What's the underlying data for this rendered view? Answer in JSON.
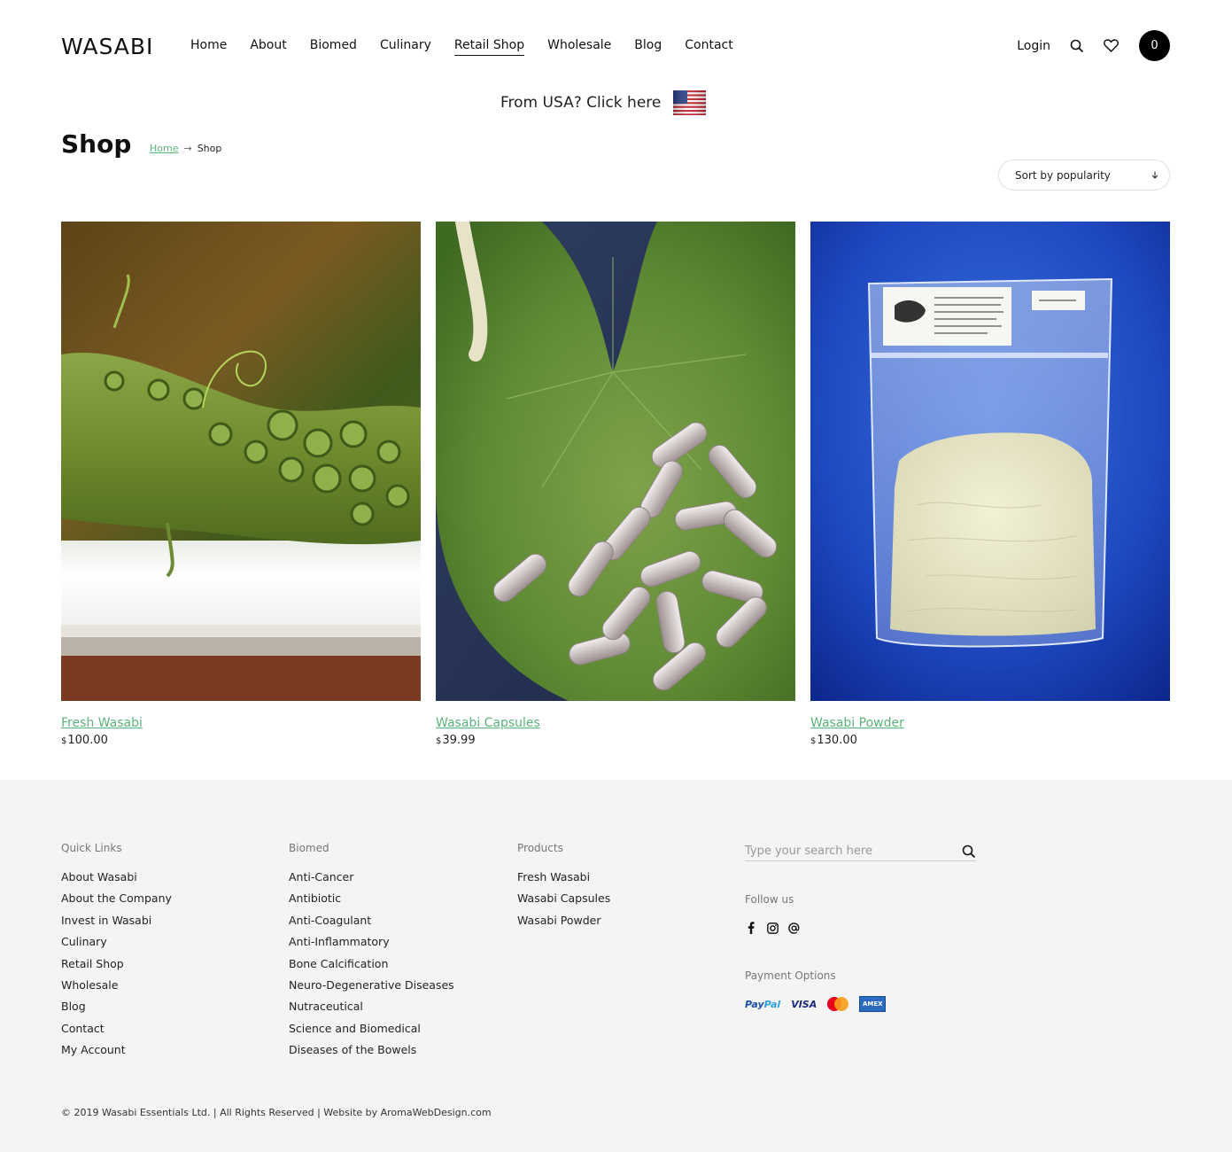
{
  "header": {
    "logo": "WASABI",
    "nav": [
      "Home",
      "About",
      "Biomed",
      "Culinary",
      "Retail Shop",
      "Wholesale",
      "Blog",
      "Contact"
    ],
    "active_nav": "Retail Shop",
    "login": "Login",
    "cart_count": "0",
    "usa_banner": "From USA? Click here"
  },
  "page": {
    "title": "Shop",
    "breadcrumb": {
      "home": "Home",
      "separator": "→",
      "current": "Shop"
    },
    "sort_label": "Sort by popularity"
  },
  "products": [
    {
      "name": "Fresh Wasabi",
      "currency": "$",
      "price": "100.00"
    },
    {
      "name": "Wasabi Capsules",
      "currency": "$",
      "price": "39.99"
    },
    {
      "name": "Wasabi Powder",
      "currency": "$",
      "price": "130.00"
    }
  ],
  "footer": {
    "quick_links": {
      "heading": "Quick Links",
      "items": [
        "About Wasabi",
        "About the Company",
        "Invest in Wasabi",
        "Culinary",
        "Retail Shop",
        "Wholesale",
        "Blog",
        "Contact",
        "My Account"
      ]
    },
    "biomed": {
      "heading": "Biomed",
      "items": [
        "Anti-Cancer",
        "Antibiotic",
        "Anti-Coagulant",
        "Anti-Inflammatory",
        "Bone Calcification",
        "Neuro-Degenerative Diseases",
        "Nutraceutical",
        "Science and Biomedical",
        "Diseases of the Bowels"
      ]
    },
    "products": {
      "heading": "Products",
      "items": [
        "Fresh Wasabi",
        "Wasabi Capsules",
        "Wasabi Powder"
      ]
    },
    "search_placeholder": "Type your search here",
    "follow_label": "Follow us",
    "social_icons": [
      "facebook-icon",
      "instagram-icon",
      "email-icon"
    ],
    "payment_label": "Payment Options",
    "payments": {
      "paypal_a": "Pay",
      "paypal_b": "Pal",
      "visa": "VISA",
      "amex": "AMEX"
    },
    "copyright": "© 2019 Wasabi Essentials Ltd. | All Rights Reserved | Website by AromaWebDesign.com"
  },
  "colors": {
    "link_green": "#5cb27a",
    "footer_bg": "#f4f4f4",
    "cart_bg": "#000000"
  }
}
